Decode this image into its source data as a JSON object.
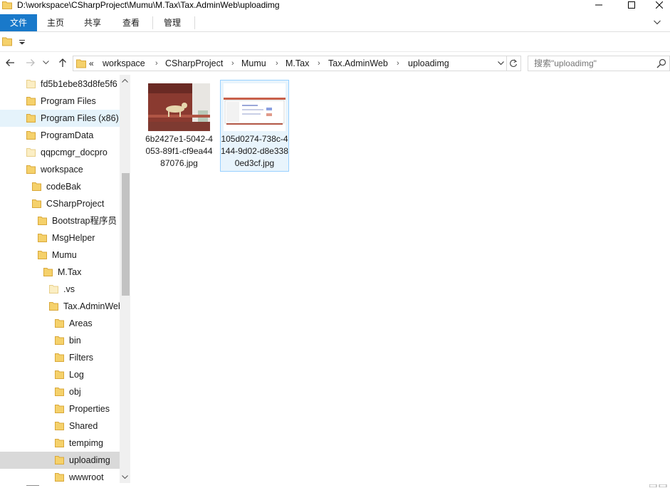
{
  "window": {
    "title": "D:\\workspace\\CSharpProject\\Mumu\\M.Tax\\Tax.AdminWeb\\uploadimg"
  },
  "ribbon": {
    "tabs": [
      "文件",
      "主页",
      "共享",
      "查看",
      "管理"
    ]
  },
  "address": {
    "overflow": "«",
    "crumbs": [
      "workspace",
      "CSharpProject",
      "Mumu",
      "M.Tax",
      "Tax.AdminWeb",
      "uploadimg"
    ]
  },
  "search": {
    "placeholder": "搜索\"uploadimg\""
  },
  "nav": {
    "items": [
      {
        "label": "fd5b1ebe83d8fe5f6",
        "state": ""
      },
      {
        "label": "Program Files",
        "state": ""
      },
      {
        "label": "Program Files (x86)",
        "state": "hover"
      },
      {
        "label": "ProgramData",
        "state": ""
      },
      {
        "label": "qqpcmgr_docpro",
        "state": ""
      },
      {
        "label": "workspace",
        "state": ""
      },
      {
        "label": "codeBak",
        "state": ""
      },
      {
        "label": "CSharpProject",
        "state": ""
      },
      {
        "label": "Bootstrap程序员",
        "state": ""
      },
      {
        "label": "MsgHelper",
        "state": ""
      },
      {
        "label": "Mumu",
        "state": ""
      },
      {
        "label": "M.Tax",
        "state": ""
      },
      {
        "label": ".vs",
        "state": ""
      },
      {
        "label": "Tax.AdminWeb",
        "state": ""
      },
      {
        "label": "Areas",
        "state": ""
      },
      {
        "label": "bin",
        "state": ""
      },
      {
        "label": "Filters",
        "state": ""
      },
      {
        "label": "Log",
        "state": ""
      },
      {
        "label": "obj",
        "state": ""
      },
      {
        "label": "Properties",
        "state": ""
      },
      {
        "label": "Shared",
        "state": ""
      },
      {
        "label": "tempimg",
        "state": ""
      },
      {
        "label": "uploadimg",
        "state": "selected"
      },
      {
        "label": "wwwroot",
        "state": ""
      }
    ]
  },
  "files": [
    {
      "name": "6b2427e1-5042-4053-89f1-cf9ea4487076.jpg",
      "selected": false
    },
    {
      "name": "105d0274-738c-4144-9d02-d8e3380ed3cf.jpg",
      "selected": true
    }
  ],
  "colors": {
    "accent": "#1979ca",
    "selection_border": "#99d1ff",
    "folder": "#f5d16b"
  }
}
